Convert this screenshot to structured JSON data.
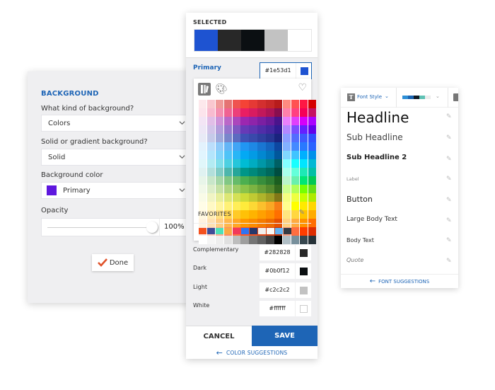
{
  "background_panel": {
    "title": "BACKGROUND",
    "kind_label": "What kind of background?",
    "kind_value": "Colors",
    "style_label": "Solid or gradient background?",
    "style_value": "Solid",
    "color_label": "Background color",
    "color_value": "Primary",
    "color_swatch": "#5e17de",
    "opacity_label": "Opacity",
    "opacity_value": "100%",
    "opacity_fraction": 1.0,
    "done_label": "Done",
    "done_icon_color": "#e0522a"
  },
  "color_picker": {
    "selected_title": "SELECTED",
    "selected_swatches": [
      "#1e53d1",
      "#282828",
      "#0b0f12",
      "#c2c2c2",
      "#ffffff"
    ],
    "primary_label": "Primary",
    "primary_hex": "#1e53d1",
    "favorites_title": "FAVORITES",
    "favorites": [
      "#f4511e",
      "#3f4d97",
      "#4ee0b8",
      "#f9a843",
      "#f23a5a",
      "#2f74f3",
      "#27386b",
      "#f1eeeb",
      "#faf8f4",
      "#63b2f0",
      "#343a44"
    ],
    "roles": [
      {
        "label": "Complementary",
        "hex": "#282828"
      },
      {
        "label": "Dark",
        "hex": "#0b0f12"
      },
      {
        "label": "Light",
        "hex": "#c2c2c2"
      },
      {
        "label": "White",
        "hex": "#ffffff"
      }
    ],
    "cancel_label": "CANCEL",
    "save_label": "SAVE",
    "suggestions_label": "COLOR SUGGESTIONS",
    "grid": [
      [
        "#fde8ec",
        "#f9c7cf",
        "#ef9a9a",
        "#e57373",
        "#ef5350",
        "#f44336",
        "#e53935",
        "#d32f2f",
        "#c62828",
        "#b71c1c",
        "#ff8a80",
        "#ff5252",
        "#ff1744",
        "#d50000"
      ],
      [
        "#fce4ec",
        "#f8bbd0",
        "#f48fb1",
        "#f06292",
        "#ec407a",
        "#e91e63",
        "#d81b60",
        "#c2185b",
        "#ad1457",
        "#880e4f",
        "#ff80ab",
        "#ff4081",
        "#f50057",
        "#c51162"
      ],
      [
        "#f3e5f5",
        "#e1bee7",
        "#ce93d8",
        "#ba68c8",
        "#ab47bc",
        "#9c27b0",
        "#8e24aa",
        "#7b1fa2",
        "#6a1b9a",
        "#4a148c",
        "#ea80fc",
        "#e040fb",
        "#d500f9",
        "#aa00ff"
      ],
      [
        "#ede7f6",
        "#d1c4e9",
        "#b39ddb",
        "#9575cd",
        "#7e57c2",
        "#673ab7",
        "#5e35b1",
        "#512da8",
        "#4527a0",
        "#311b92",
        "#b388ff",
        "#7c4dff",
        "#651fff",
        "#6200ea"
      ],
      [
        "#e8eaf6",
        "#c5cae9",
        "#9fa8da",
        "#7986cb",
        "#5c6bc0",
        "#3f51b5",
        "#3949ab",
        "#303f9f",
        "#283593",
        "#1a237e",
        "#8c9eff",
        "#536dfe",
        "#3d5afe",
        "#304ffe"
      ],
      [
        "#e3f2fd",
        "#bbdefb",
        "#90caf9",
        "#64b5f6",
        "#42a5f5",
        "#2196f3",
        "#1e88e5",
        "#1976d2",
        "#1565c0",
        "#0d47a1",
        "#82b1ff",
        "#448aff",
        "#2979ff",
        "#2962ff"
      ],
      [
        "#e1f5fe",
        "#b3e5fc",
        "#81d4fa",
        "#4fc3f7",
        "#29b6f6",
        "#03a9f4",
        "#039be5",
        "#0288d1",
        "#0277bd",
        "#01579b",
        "#80d8ff",
        "#40c4ff",
        "#00b0ff",
        "#0091ea"
      ],
      [
        "#e0f7fa",
        "#b2ebf2",
        "#80deea",
        "#4dd0e1",
        "#26c6da",
        "#00bcd4",
        "#00acc1",
        "#0097a7",
        "#00838f",
        "#006064",
        "#84ffff",
        "#18ffff",
        "#00e5ff",
        "#00b8d4"
      ],
      [
        "#e0f2f1",
        "#b2dfdb",
        "#80cbc4",
        "#4db6ac",
        "#26a69a",
        "#009688",
        "#00897b",
        "#00796b",
        "#00695c",
        "#004d40",
        "#a7ffeb",
        "#64ffda",
        "#1de9b6",
        "#00bfa5"
      ],
      [
        "#e8f5e9",
        "#c8e6c9",
        "#a5d6a7",
        "#81c784",
        "#66bb6a",
        "#4caf50",
        "#43a047",
        "#388e3c",
        "#2e7d32",
        "#1b5e20",
        "#b9f6ca",
        "#69f0ae",
        "#00e676",
        "#00c853"
      ],
      [
        "#f1f8e9",
        "#dcedc8",
        "#c5e1a5",
        "#aed581",
        "#9ccc65",
        "#8bc34a",
        "#7cb342",
        "#689f38",
        "#558b2f",
        "#33691e",
        "#ccff90",
        "#b2ff59",
        "#76ff03",
        "#64dd17"
      ],
      [
        "#f9fbe7",
        "#f0f4c3",
        "#e6ee9c",
        "#dce775",
        "#d4e157",
        "#cddc39",
        "#c0ca33",
        "#afb42b",
        "#9e9d24",
        "#827717",
        "#f4ff81",
        "#eeff41",
        "#c6ff00",
        "#aeea00"
      ],
      [
        "#fffde7",
        "#fff9c4",
        "#fff59d",
        "#fff176",
        "#ffee58",
        "#ffeb3b",
        "#fdd835",
        "#fbc02d",
        "#f9a825",
        "#f57f17",
        "#ffff8d",
        "#ffff00",
        "#ffea00",
        "#ffd600"
      ],
      [
        "#fff8e1",
        "#ffecb3",
        "#ffe082",
        "#ffd54f",
        "#ffca28",
        "#ffc107",
        "#ffb300",
        "#ffa000",
        "#ff8f00",
        "#ff6f00",
        "#ffe57f",
        "#ffd740",
        "#ffc400",
        "#ffab00"
      ],
      [
        "#fff3e0",
        "#ffe0b2",
        "#ffcc80",
        "#ffb74d",
        "#ffa726",
        "#ff9800",
        "#fb8c00",
        "#f57c00",
        "#ef6c00",
        "#e65100",
        "#ffd180",
        "#ffab40",
        "#ff9100",
        "#ff6d00"
      ],
      [
        "#fbe9e7",
        "#ffccbc",
        "#ffab91",
        "#ff8a65",
        "#ff7043",
        "#ff5722",
        "#f4511e",
        "#e64a19",
        "#d84315",
        "#bf360c",
        "#ff9e80",
        "#ff6e40",
        "#ff3d00",
        "#dd2c00"
      ],
      [
        "#ffffff",
        "#f5f5f5",
        "#eeeeee",
        "#e0e0e0",
        "#bdbdbd",
        "#9e9e9e",
        "#757575",
        "#616161",
        "#424242",
        "#000000",
        "#b0bec5",
        "#78909c",
        "#37474f",
        "#263238"
      ]
    ]
  },
  "font_panel": {
    "font_style_label": "Font Style",
    "palette_preview": [
      "#2e8fd6",
      "#1a63b0",
      "#0f1a24",
      "#5fc1b4",
      "#ececec"
    ],
    "items": [
      {
        "label": "Headline"
      },
      {
        "label": "Sub Headline"
      },
      {
        "label": "Sub Headline 2"
      },
      {
        "label": "Label"
      },
      {
        "label": "Button"
      },
      {
        "label": "Large Body Text"
      },
      {
        "label": "Body Text"
      },
      {
        "label": "Quote"
      }
    ],
    "suggestions_label": "FONT SUGGESTIONS"
  }
}
